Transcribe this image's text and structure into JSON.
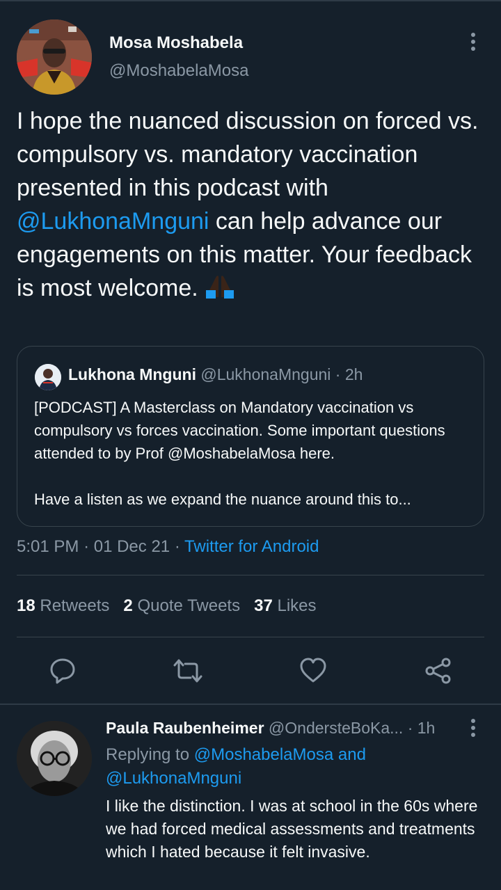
{
  "tweet": {
    "author_name": "Mosa Moshabela",
    "author_handle": "@MoshabelaMosa",
    "text_before": "I hope the nuanced discussion on forced vs. compulsory vs. mandatory vaccination presented in this podcast with ",
    "mention": "@LukhonaMnguni",
    "text_after": " can help advance our engagements on this matter. Your feedback is most welcome. ",
    "emoji": "folded-hands-emoji",
    "time": "5:01 PM",
    "date": "01 Dec 21",
    "source": "Twitter for Android",
    "sep": "·"
  },
  "quote": {
    "name": "Lukhona Mnguni",
    "handle": "@LukhonaMnguni",
    "age": "2h",
    "sep": "·",
    "text_line1": "[PODCAST] A Masterclass on Mandatory vaccination vs compulsory vs forces vaccination. Some important questions attended to by Prof @MoshabelaMosa here.",
    "text_line2": "Have a listen as we expand the nuance around this to..."
  },
  "stats": {
    "retweets_count": "18",
    "retweets_label": "Retweets",
    "quotes_count": "2",
    "quotes_label": "Quote Tweets",
    "likes_count": "37",
    "likes_label": "Likes"
  },
  "actions": [
    "reply-icon",
    "retweet-icon",
    "like-icon",
    "share-icon"
  ],
  "reply": {
    "name": "Paula Raubenheimer",
    "handle": "@OndersteBoKa...",
    "age": "1h",
    "sep": "·",
    "replying_prefix": "Replying to ",
    "replying_to": "@MoshabelaMosa and @LukhonaMnguni",
    "text": "I like the distinction. I was at school in the 60s where we had forced medical assessments and treatments which I hated because it felt invasive."
  },
  "colors": {
    "background": "#15202b",
    "accent": "#1d9bf0",
    "muted": "#8b98a5",
    "border": "#38444d"
  }
}
